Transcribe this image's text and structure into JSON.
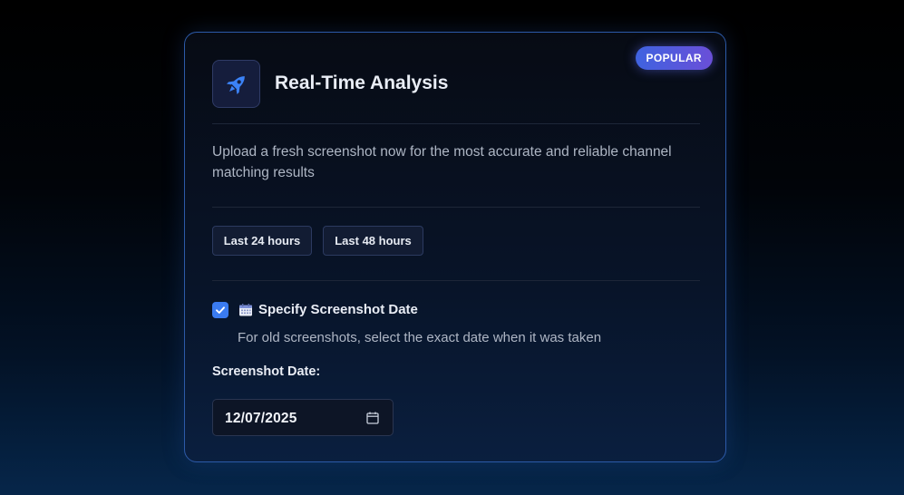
{
  "card": {
    "badge": "POPULAR",
    "icon": "rocket-icon",
    "title": "Real-Time Analysis",
    "description": "Upload a fresh screenshot now for the most accurate and reliable channel matching results",
    "time_filters": [
      {
        "label": "Last 24 hours"
      },
      {
        "label": "Last 48 hours"
      }
    ],
    "specify_date": {
      "checked": true,
      "icon": "calendar-icon",
      "label": "Specify Screenshot Date",
      "hint": "For old screenshots, select the exact date when it was taken"
    },
    "date_field": {
      "label": "Screenshot Date:",
      "value": "12/07/2025",
      "picker_icon": "calendar-picker-icon"
    }
  },
  "colors": {
    "accent": "#3a7bf0",
    "badge_start": "#3f63e0",
    "badge_end": "#6a4fd8",
    "card_border": "#2c5aa8"
  }
}
